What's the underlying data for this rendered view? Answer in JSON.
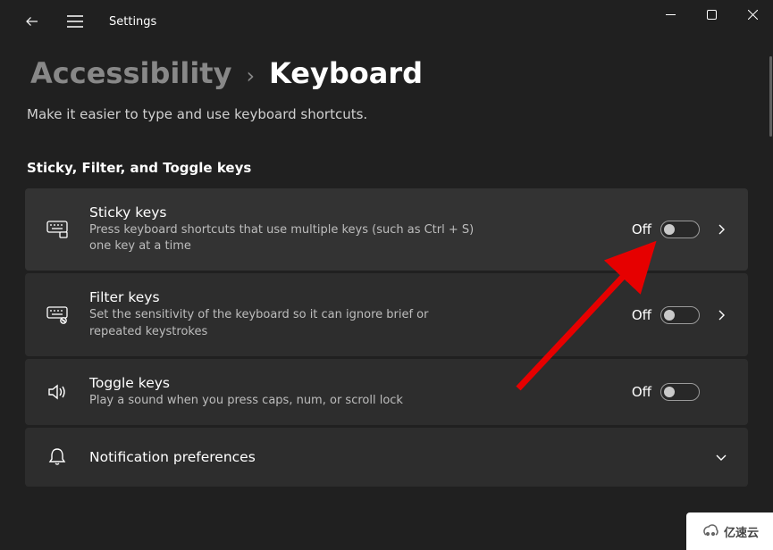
{
  "app_title": "Settings",
  "breadcrumb": {
    "parent": "Accessibility",
    "current": "Keyboard"
  },
  "page_description": "Make it easier to type and use keyboard shortcuts.",
  "section_title": "Sticky, Filter, and Toggle keys",
  "rows": {
    "sticky": {
      "title": "Sticky keys",
      "desc": "Press keyboard shortcuts that use multiple keys (such as Ctrl + S) one key at a time",
      "state": "Off"
    },
    "filter": {
      "title": "Filter keys",
      "desc": "Set the sensitivity of the keyboard so it can ignore brief or repeated keystrokes",
      "state": "Off"
    },
    "toggle": {
      "title": "Toggle keys",
      "desc": "Play a sound when you press caps, num, or scroll lock",
      "state": "Off"
    },
    "notif": {
      "title": "Notification preferences"
    }
  },
  "watermark_text": "亿速云"
}
